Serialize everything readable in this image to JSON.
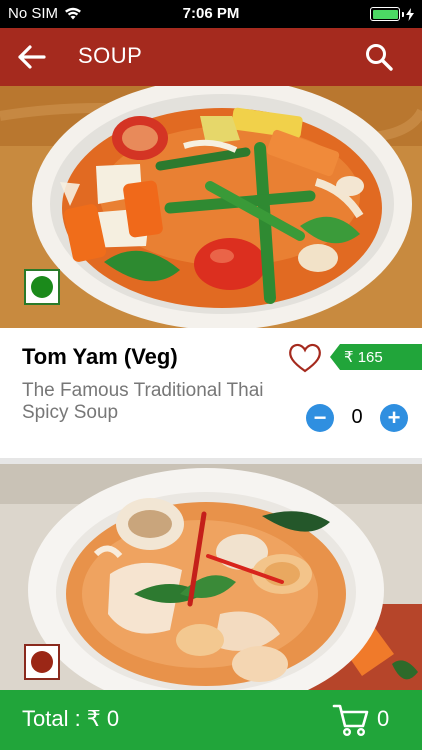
{
  "status": {
    "carrier": "No SIM",
    "time": "7:06 PM",
    "battery_level": 1.0
  },
  "app_bar": {
    "title": "SOUP",
    "back_icon": "arrow-left-icon",
    "search_icon": "search-icon"
  },
  "items": [
    {
      "name": "Tom Yam (Veg)",
      "description": "The Famous Traditional Thai Spicy Soup",
      "price": "₹ 165",
      "quantity": "0",
      "minus_label": "−",
      "plus_label": "+",
      "type": "veg"
    },
    {
      "type": "non-veg"
    }
  ],
  "bottom_bar": {
    "total_label": "Total : ₹ 0",
    "cart_count": "0",
    "cart_icon": "cart-icon"
  },
  "colors": {
    "app_bar": "#a52a1e",
    "accent_green": "#21a53a",
    "qty_button": "#2f8fe0"
  }
}
